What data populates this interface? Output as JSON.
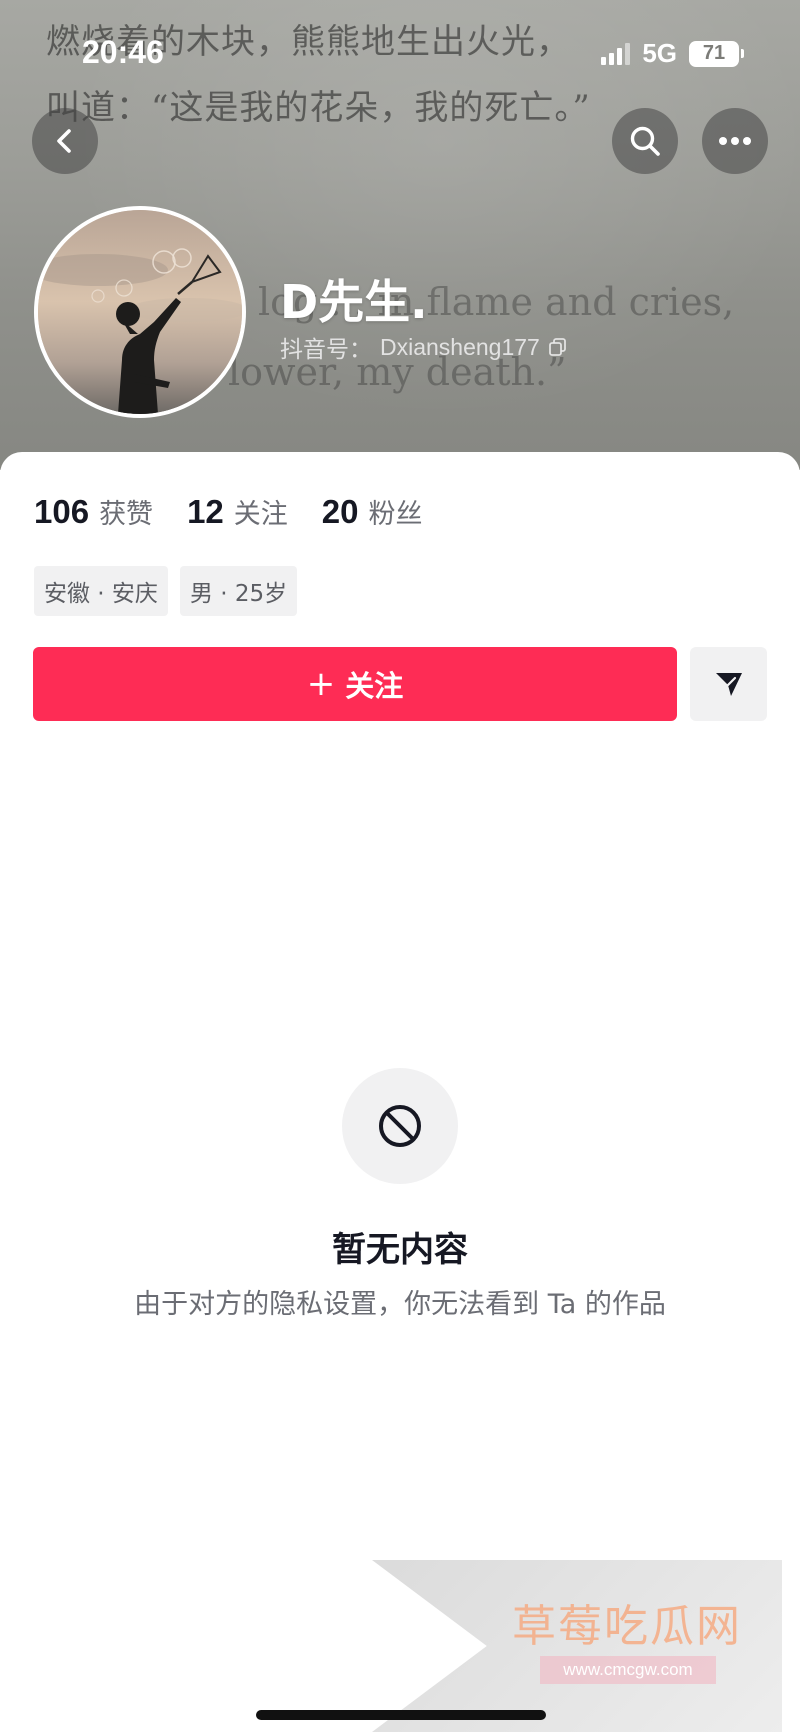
{
  "status_bar": {
    "time": "20:46",
    "network": "5G",
    "battery": "71"
  },
  "background": {
    "cn_line1": "燃烧着的木块，熊熊地生出火光，",
    "cn_line2": "叫道：“这是我的花朵，我的死亡。”",
    "en_line1": "log ... in flame and cries,",
    "en_line2": "lower, my death.”"
  },
  "nav": {
    "back_icon": "chevron-left-icon",
    "search_icon": "search-icon",
    "more_icon": "more-horizontal-icon"
  },
  "profile": {
    "nickname": "D先生.",
    "account_label": "抖音号：",
    "account_id": "Dxiansheng177"
  },
  "stats": [
    {
      "value": "106",
      "label": "获赞"
    },
    {
      "value": "12",
      "label": "关注"
    },
    {
      "value": "20",
      "label": "粉丝"
    }
  ],
  "tags": [
    "安徽 · 安庆",
    "男 · 25岁"
  ],
  "actions": {
    "follow_plus": "+",
    "follow_label": "关注",
    "share_icon": "send-icon"
  },
  "empty_state": {
    "icon": "ban-icon",
    "title": "暂无内容",
    "subtitle": "由于对方的隐私设置，你无法看到 Ta 的作品"
  },
  "watermark": {
    "title": "草莓吃瓜网",
    "url": "www.cmcgw.com"
  },
  "colors": {
    "accent": "#fe2c55",
    "text_primary": "#161823",
    "text_secondary": "#6b6d74"
  }
}
